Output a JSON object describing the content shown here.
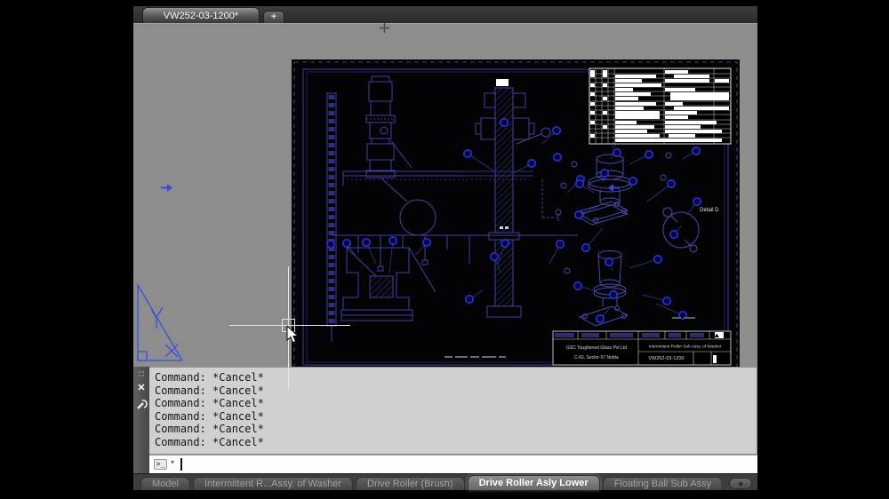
{
  "window": {
    "file_tab_label": "VW252-03-1200*",
    "new_tab_label": "+"
  },
  "viewport": {
    "detail_label": "Detail D",
    "title_block": {
      "company": "GSC Toughened Glass Pvt Ltd",
      "address": "C-60, Sector-57 Noida",
      "assembly_title": "Intermittent Roller Sub Assy. of Washer",
      "drawing_number": "VW252-03-1200"
    }
  },
  "command_panel": {
    "history_lines": [
      "Command: *Cancel*",
      "Command: *Cancel*",
      "Command: *Cancel*",
      "Command: *Cancel*",
      "Command: *Cancel*",
      "Command: *Cancel*"
    ],
    "prompt_glyph": ">_",
    "caret_glyph": "▾",
    "close_glyph": "✕",
    "input_value": ""
  },
  "layout_tabs": {
    "tabs": [
      {
        "label": "Model",
        "active": false
      },
      {
        "label": "Intermittent R...Assy. of Washer",
        "active": false
      },
      {
        "label": "Drive Roller (Brush)",
        "active": false
      },
      {
        "label": "Drive Roller Asly Lower",
        "active": true
      },
      {
        "label": "Floating Ball Sub Assy",
        "active": false
      }
    ],
    "overflow_glyph": "◆"
  },
  "colors": {
    "canvas_gray": "#8d8d8d",
    "paper_black": "#030305",
    "drawing_line_blue": "#4242a0",
    "balloon_blue": "#2433e0",
    "command_bg": "#d0d0d0",
    "highlight_white": "#ffffff"
  }
}
